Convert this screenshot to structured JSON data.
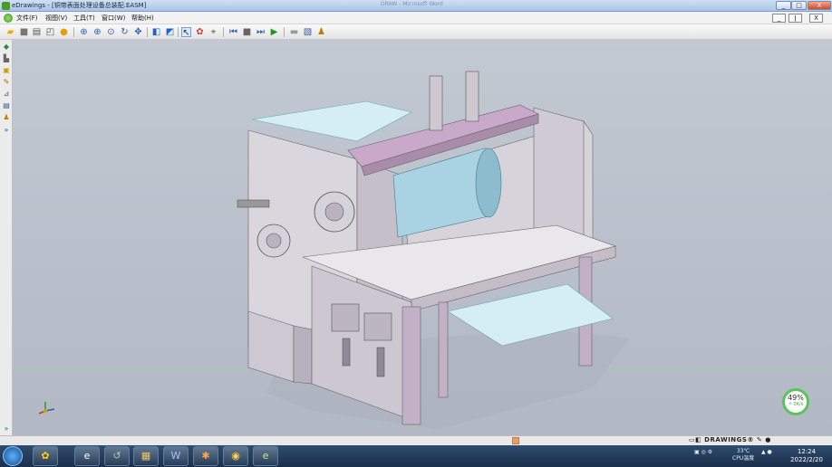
{
  "window": {
    "title": "eDrawings - [铜带表面处理设备总装配.EASM]",
    "ghost_title": "DRAW  -  Microsoft Word",
    "buttons": {
      "minimize": "_",
      "maximize": "□",
      "close": "X"
    }
  },
  "menu": {
    "items": [
      "文件(F)",
      "视图(V)",
      "工具(T)",
      "窗口(W)",
      "帮助(H)"
    ],
    "doc_buttons": {
      "minimize": "_",
      "restore": "ǀ",
      "close": "X"
    }
  },
  "toolbar": {
    "icons": [
      "open-icon",
      "save-icon",
      "print-icon",
      "print-preview-icon",
      "help-icon",
      "zoom-fit-icon",
      "zoom-in-icon",
      "zoom-area-icon",
      "rotate-icon",
      "pan-icon",
      "shaded-view-icon",
      "perspective-icon",
      "select-icon",
      "markup-icon",
      "measure-icon",
      "first-frame-icon",
      "stop-icon",
      "step-forward-icon",
      "play-icon",
      "section-icon",
      "explode-icon",
      "stamp-icon"
    ],
    "colors": {
      "accent": "#1f62c9",
      "play": "#1a9a1a"
    }
  },
  "sidebar": {
    "icons": [
      "components-icon",
      "configurations-icon",
      "views-icon",
      "markup-icon",
      "measure-icon",
      "stamp-icon",
      "properties-icon",
      "expand-icon"
    ]
  },
  "viewport": {
    "model_colors": {
      "frame": "#d6d1dc",
      "accent": "#b39ab8",
      "roller": "#9fc7d9",
      "sheet": "#d4eef4"
    }
  },
  "badge": {
    "value": "49",
    "unit": "%",
    "sub": "↑ 0K/s"
  },
  "statusbar": {
    "brand": "DRAWINGS®"
  },
  "taskbar": {
    "apps": [
      "explorer-icon",
      "ie-icon",
      "folder-icon",
      "word-icon",
      "app-icon",
      "chrome-icon",
      "edrawings-icon"
    ],
    "temp": "33℃",
    "temp_label": "CPU温度",
    "time": "12:24",
    "date": "2022/2/20"
  }
}
